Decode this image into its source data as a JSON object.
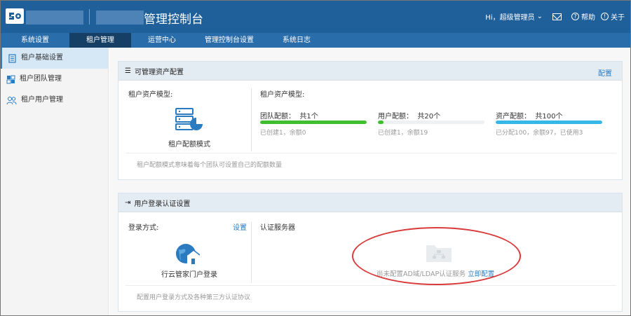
{
  "header": {
    "title": "管理控制台",
    "greeting": "Hi，超级管理员",
    "help": "帮助",
    "about": "关于"
  },
  "nav": {
    "items": [
      {
        "label": "系统设置"
      },
      {
        "label": "租户管理"
      },
      {
        "label": "运营中心"
      },
      {
        "label": "管理控制台设置"
      },
      {
        "label": "系统日志"
      }
    ]
  },
  "sidebar": {
    "items": [
      {
        "label": "租户基础设置"
      },
      {
        "label": "租户团队管理"
      },
      {
        "label": "租户用户管理"
      }
    ]
  },
  "asset_panel": {
    "title": "可管理资产配置",
    "config_link": "配置",
    "left_label": "租户资产模型:",
    "mode_label": "租户配额模式",
    "right_label": "租户资产模型:",
    "quotas": [
      {
        "title": "团队配额：",
        "total": "共1个",
        "detail": "已创建1，余额0",
        "fill": 1.0,
        "color": "#3fbf2f"
      },
      {
        "title": "用户配额：",
        "total": "共20个",
        "detail": "已创建1，余额19",
        "fill": 0.05,
        "color": "#3fbf2f"
      },
      {
        "title": "资产配额：",
        "total": "共100个",
        "detail": "已分配100，余额97，已使用3",
        "fill": 1.0,
        "color": "#35b8e6"
      }
    ],
    "footer_note": "租户配额模式意味着每个团队可设置自己的配额数量"
  },
  "login_panel": {
    "title": "用户登录认证设置",
    "method_label": "登录方式:",
    "set_link": "设置",
    "method_name": "行云管家门户登录",
    "auth_label": "认证服务器",
    "auth_empty": "尚未配置AD域/LDAP认证服务",
    "auth_config_link": "立即配置",
    "footer_note": "配置用户登录方式及各种第三方认证协议"
  },
  "colors": {
    "header_bg": "#1f5f9a",
    "nav_bg": "#2a6dab",
    "nav_active": "#163f66",
    "link": "#2a7bc0",
    "annotation": "#d93a3a"
  }
}
